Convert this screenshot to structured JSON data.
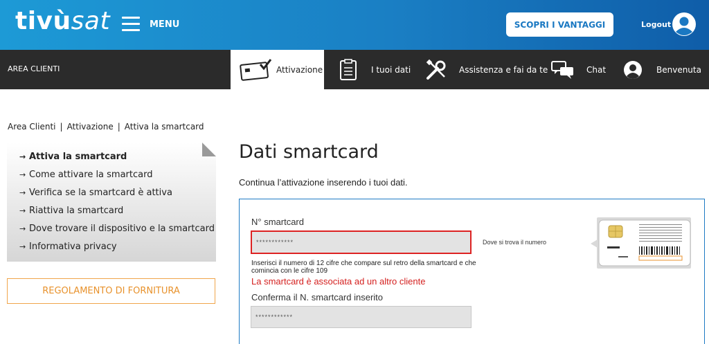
{
  "header": {
    "logo_part1": "tivù",
    "logo_part2": "sat",
    "menu_label": "MENU",
    "scopri_button": "SCOPRI I VANTAGGI",
    "logout_label": "Logout"
  },
  "nav": {
    "area_clienti": "AREA CLIENTI",
    "items": [
      {
        "label": "Attivazione",
        "icon": "card-check-icon"
      },
      {
        "label": "I tuoi dati",
        "icon": "clipboard-icon"
      },
      {
        "label": "Assistenza e fai da te",
        "icon": "tools-icon"
      },
      {
        "label": "Chat",
        "icon": "chat-icon"
      },
      {
        "label": "Benvenuta",
        "icon": "user-icon"
      }
    ]
  },
  "breadcrumb": [
    "Area Clienti",
    "Attivazione",
    "Attiva la smartcard"
  ],
  "sidemenu": {
    "items": [
      "Attiva la smartcard",
      "Come attivare la smartcard",
      "Verifica se la smartcard è attiva",
      "Riattiva la smartcard",
      "Dove trovare il dispositivo e la smartcard",
      "Informativa privacy"
    ],
    "regolamento": "REGOLAMENTO DI FORNITURA"
  },
  "main": {
    "title": "Dati smartcard",
    "subtitle": "Continua l’attivazione inserendo i tuoi dati.",
    "smartcard_label": "N° smartcard",
    "smartcard_value": "************",
    "where_link": "Dove si trova il numero",
    "hint": "Inserisci il numero di 12 cifre che compare sul retro della smartcard e che comincia con le cifre 109",
    "error": "La smartcard è associata ad un altro cliente",
    "confirm_label": "Conferma il N. smartcard inserito",
    "confirm_value": "************"
  },
  "colors": {
    "header_blue": "#1a7fc4",
    "nav_dark": "#2b2b2b",
    "error_red": "#d4201f",
    "accent_orange": "#e8922c"
  }
}
